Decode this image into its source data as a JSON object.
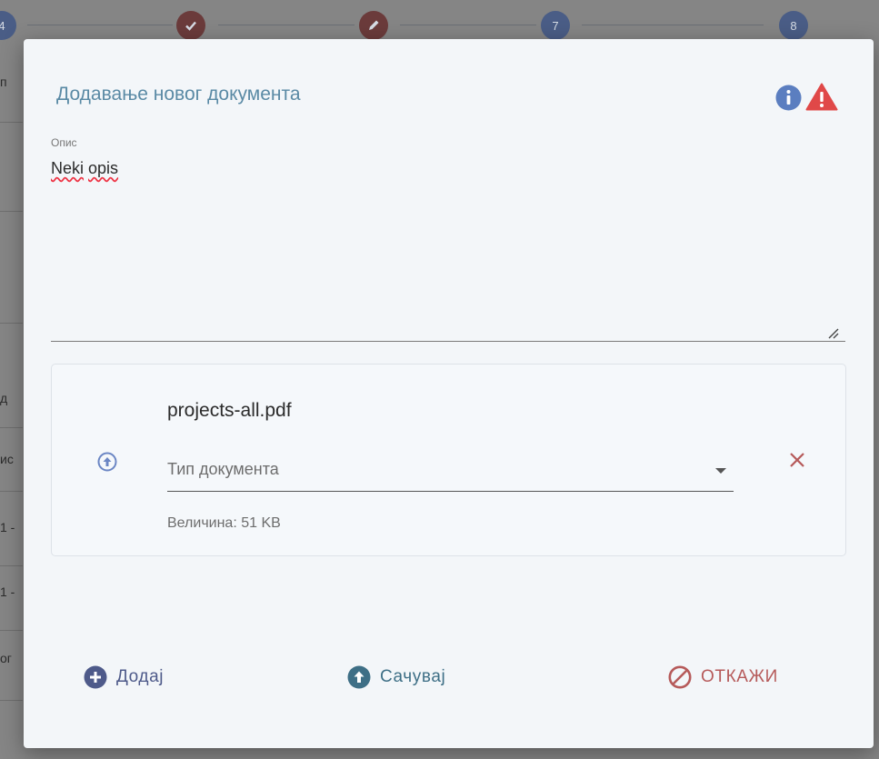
{
  "stepper": {
    "steps": [
      {
        "label": "4",
        "state": "blue"
      },
      {
        "label": "",
        "state": "done",
        "icon": "check-icon"
      },
      {
        "label": "",
        "state": "editing",
        "icon": "pencil-icon"
      },
      {
        "label": "7",
        "state": "blue"
      },
      {
        "label": "8",
        "state": "blue"
      }
    ]
  },
  "background": {
    "fragments": [
      "п",
      "д",
      "ис",
      "1 -",
      "1 -",
      "ог"
    ]
  },
  "dialog": {
    "title": "Додавање новог документа",
    "description": {
      "label": "Опис",
      "value_word1": "Neki",
      "value_word2": "opis"
    },
    "file": {
      "name": "projects-all.pdf",
      "type_placeholder": "Тип документа",
      "size": "Величина: 51 KB"
    },
    "actions": {
      "add": "Додај",
      "save": "Сачувај",
      "cancel": "ОТКАЖИ"
    }
  },
  "colors": {
    "title": "#5a8aa5",
    "info": "#5b7ec0",
    "warning": "#e04848",
    "add": "#4e5a8a",
    "save": "#3e6f86",
    "cancel": "#b65a5a",
    "dialog_bg": "#f3f6f9"
  }
}
